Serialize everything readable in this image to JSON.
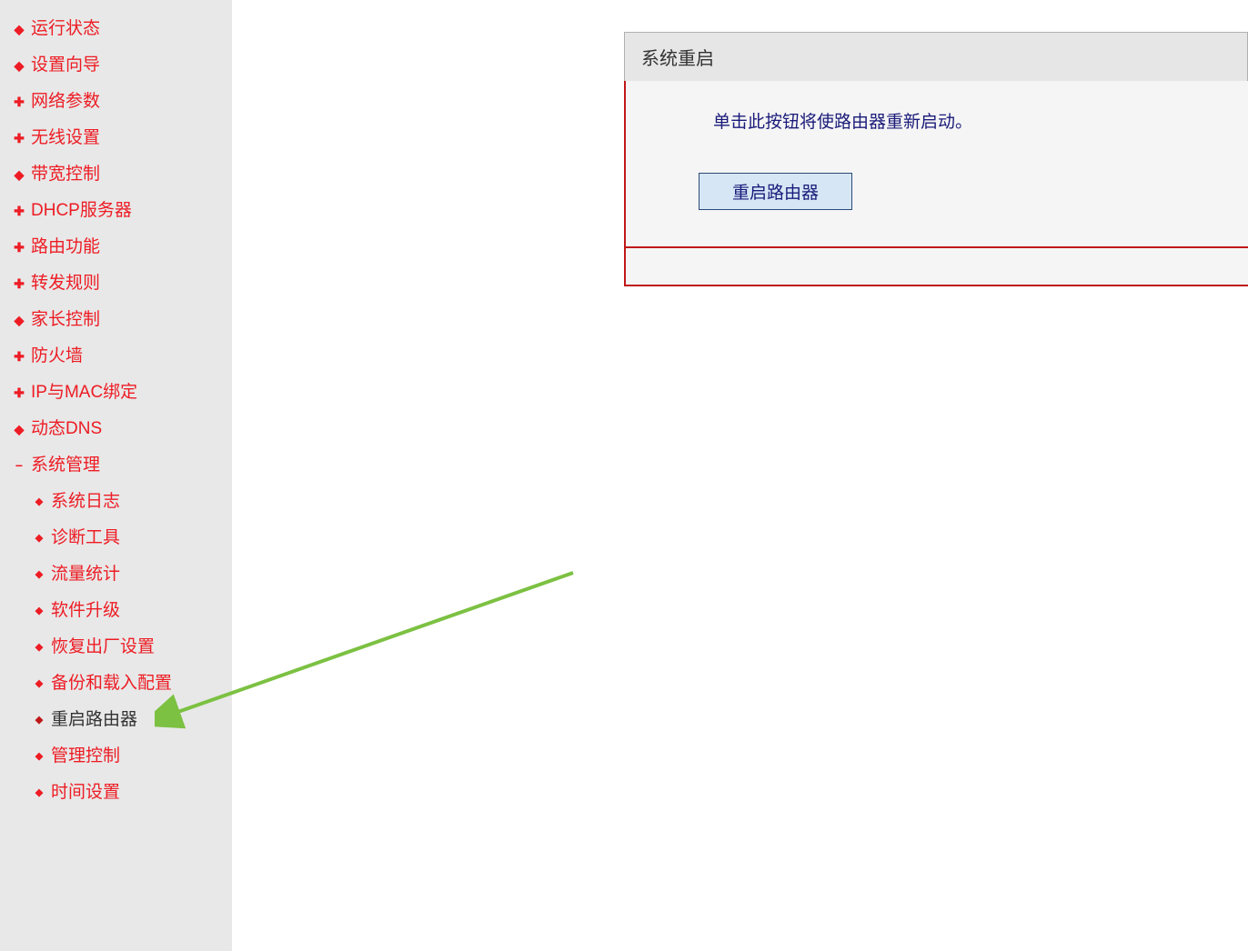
{
  "sidebar": {
    "items": [
      {
        "icon": "bullet",
        "label": "运行状态"
      },
      {
        "icon": "bullet",
        "label": "设置向导"
      },
      {
        "icon": "plus",
        "label": "网络参数"
      },
      {
        "icon": "plus",
        "label": "无线设置"
      },
      {
        "icon": "bullet",
        "label": "带宽控制"
      },
      {
        "icon": "plus",
        "label": "DHCP服务器"
      },
      {
        "icon": "plus",
        "label": "路由功能"
      },
      {
        "icon": "plus",
        "label": "转发规则"
      },
      {
        "icon": "bullet",
        "label": "家长控制"
      },
      {
        "icon": "plus",
        "label": "防火墙"
      },
      {
        "icon": "plus",
        "label": "IP与MAC绑定"
      },
      {
        "icon": "bullet",
        "label": "动态DNS"
      },
      {
        "icon": "minus",
        "label": "系统管理"
      }
    ],
    "subItems": [
      {
        "label": "系统日志"
      },
      {
        "label": "诊断工具"
      },
      {
        "label": "流量统计"
      },
      {
        "label": "软件升级"
      },
      {
        "label": "恢复出厂设置"
      },
      {
        "label": "备份和载入配置"
      },
      {
        "label": "重启路由器",
        "active": true
      },
      {
        "label": "管理控制"
      },
      {
        "label": "时间设置"
      }
    ]
  },
  "panel": {
    "title": "系统重启",
    "description": "单击此按钮将使路由器重新启动。",
    "buttonLabel": "重启路由器"
  }
}
